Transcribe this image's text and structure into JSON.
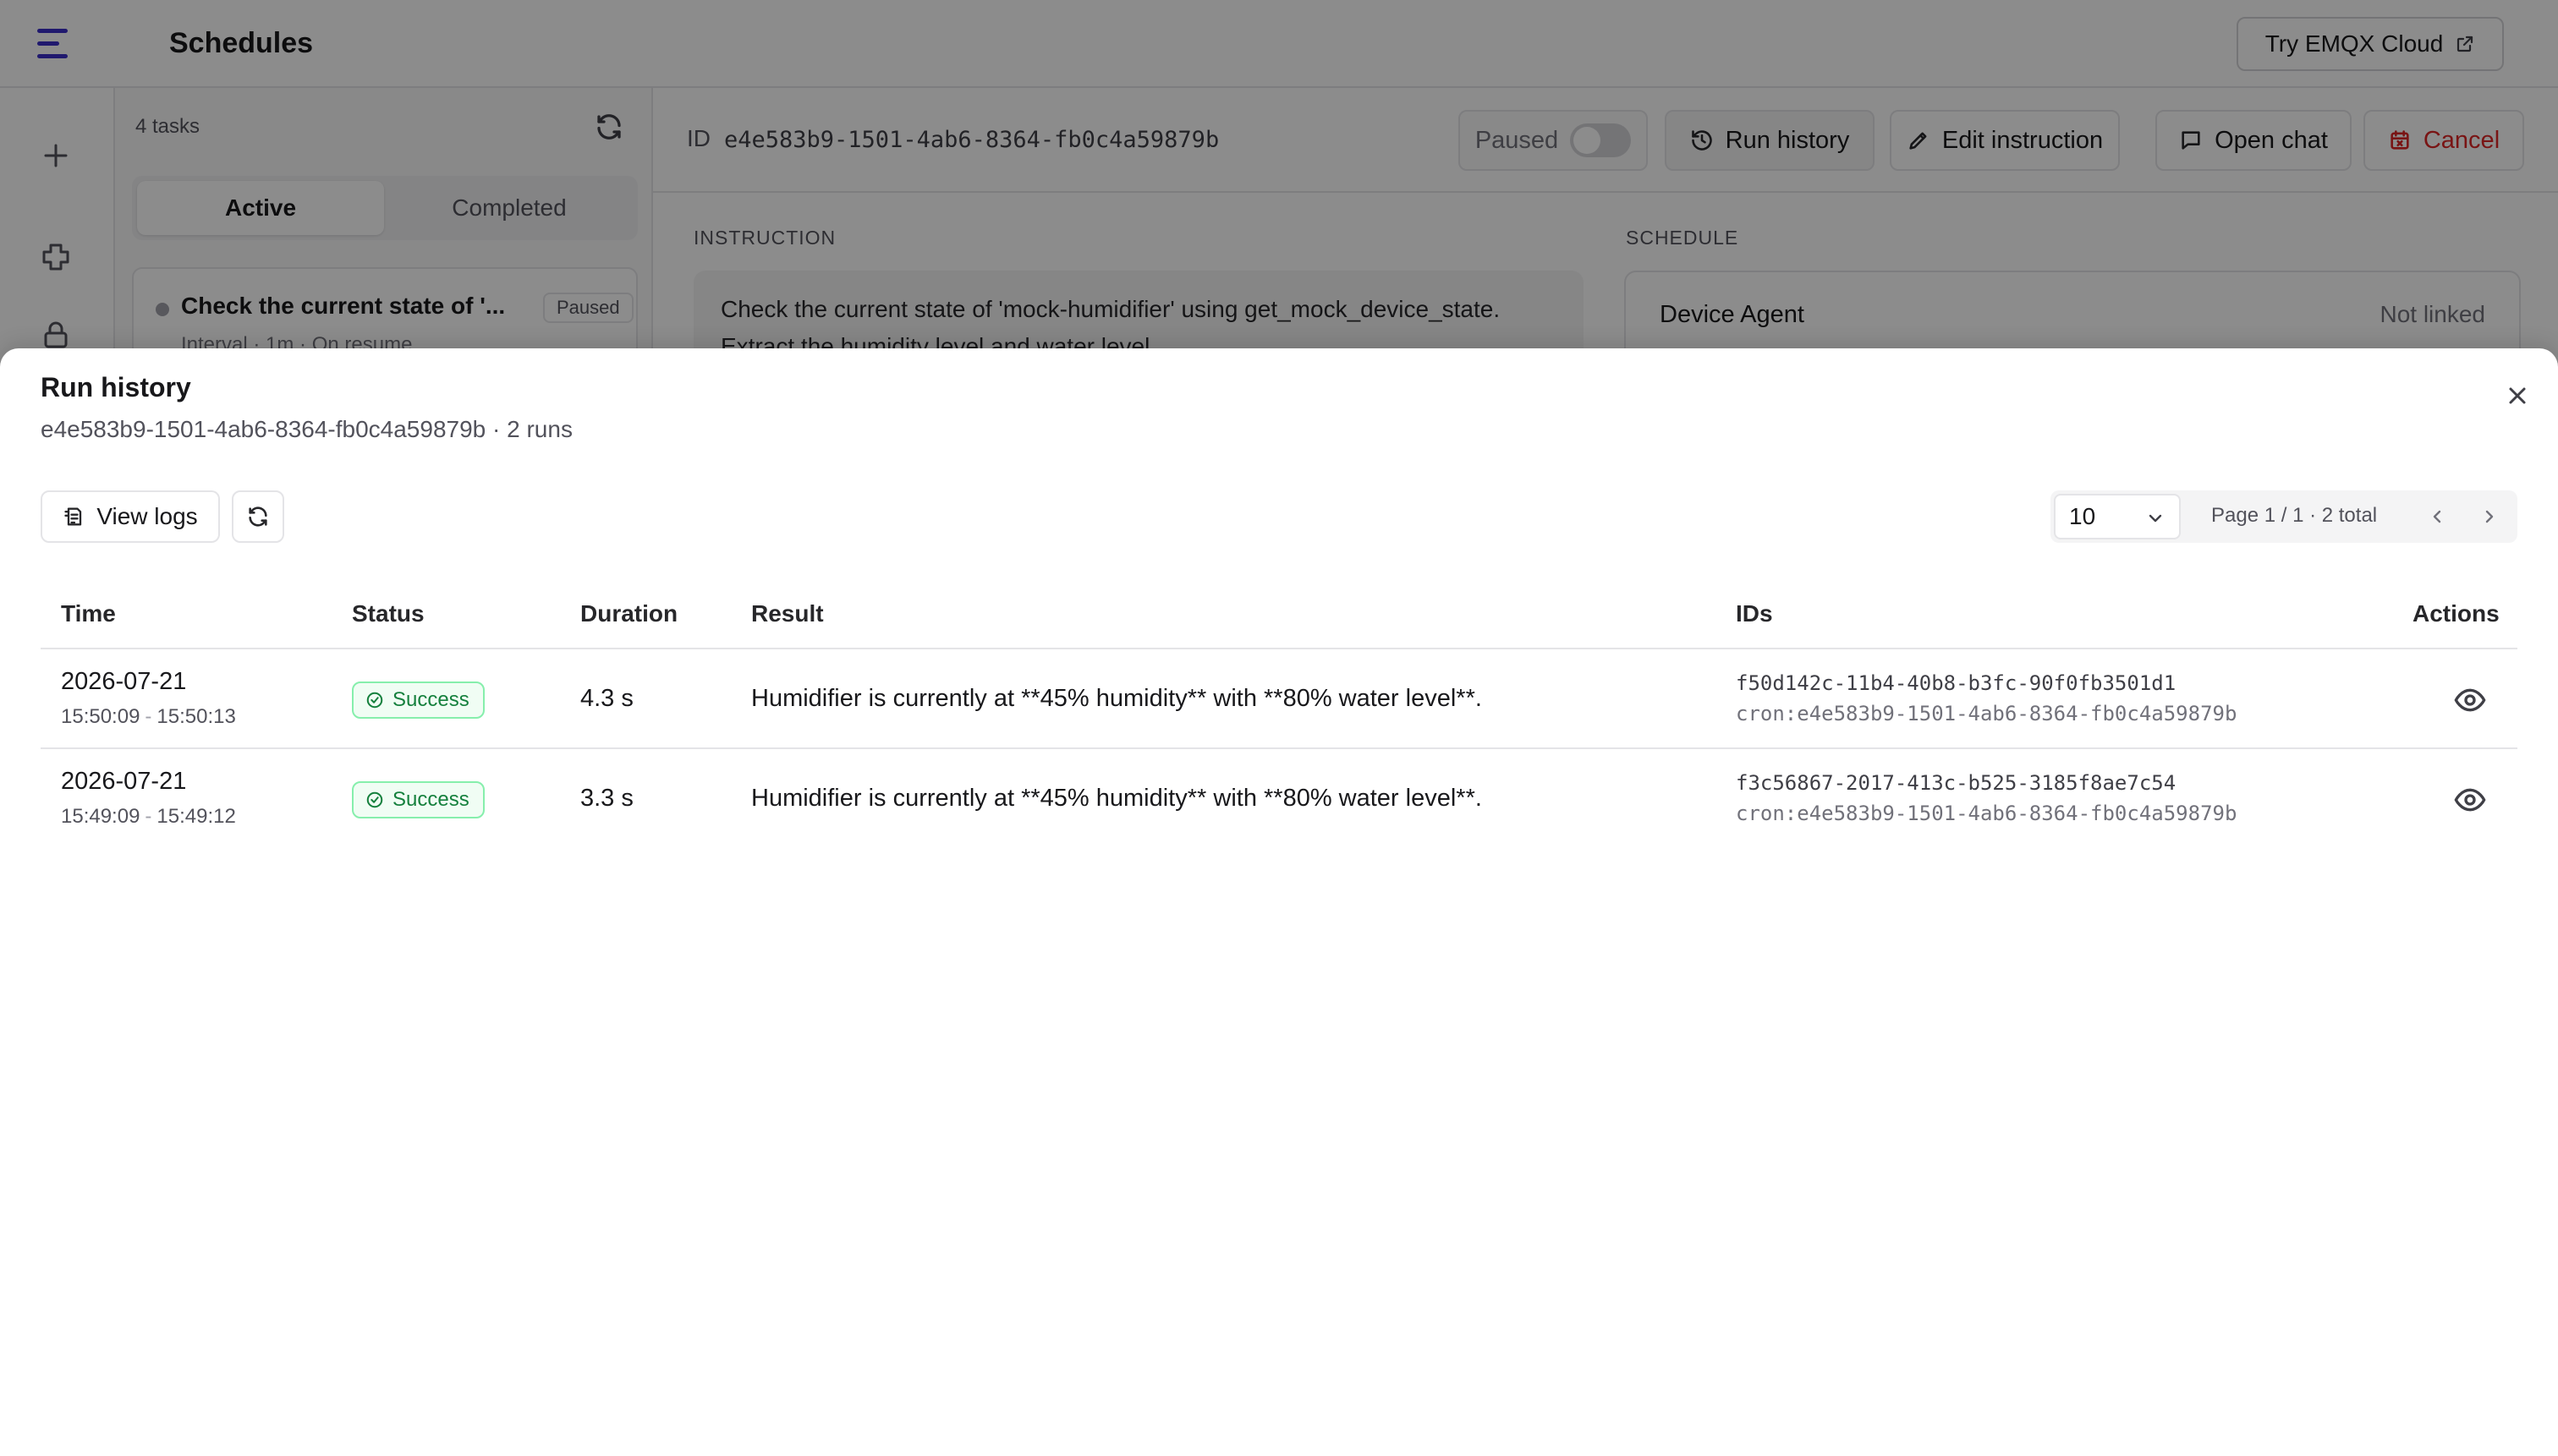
{
  "app": {
    "title": "Schedules",
    "try_button": "Try EMQX Cloud"
  },
  "list": {
    "count_label": "4 tasks",
    "tabs": [
      {
        "label": "Active"
      },
      {
        "label": "Completed"
      }
    ],
    "task": {
      "title": "Check the current state of '...",
      "badge": "Paused",
      "meta": "Interval · 1m · On resume"
    }
  },
  "detail": {
    "id_label": "ID",
    "id_value": "e4e583b9-1501-4ab6-8364-fb0c4a59879b",
    "paused_label": "Paused",
    "paused_on": false,
    "buttons": {
      "run_history": "Run history",
      "edit_instruction": "Edit instruction",
      "open_chat": "Open chat",
      "cancel": "Cancel"
    },
    "instruction_label": "INSTRUCTION",
    "instruction_text": "Check the current state of 'mock-humidifier' using get_mock_device_state. Extract the humidity level and water level",
    "schedule_label": "SCHEDULE",
    "schedule_name": "Device Agent",
    "schedule_status": "Not linked"
  },
  "drawer": {
    "title": "Run history",
    "subtitle": "e4e583b9-1501-4ab6-8364-fb0c4a59879b · 2 runs",
    "view_logs": "View logs",
    "page_size": "10",
    "page_info": "Page 1 / 1 · 2 total",
    "columns": {
      "time": "Time",
      "status": "Status",
      "duration": "Duration",
      "result": "Result",
      "ids": "IDs",
      "actions": "Actions"
    },
    "rows": [
      {
        "date": "2026-07-21",
        "start": "15:50:09",
        "sep": "-",
        "end": "15:50:13",
        "status": "Success",
        "duration": "4.3 s",
        "result": "Humidifier is currently at **45% humidity** with **80% water level**.",
        "run_id": "f50d142c-11b4-40b8-b3fc-90f0fb3501d1",
        "job_id": "cron:e4e583b9-1501-4ab6-8364-fb0c4a59879b"
      },
      {
        "date": "2026-07-21",
        "start": "15:49:09",
        "sep": "-",
        "end": "15:49:12",
        "status": "Success",
        "duration": "3.3 s",
        "result": "Humidifier is currently at **45% humidity** with **80% water level**.",
        "run_id": "f3c56867-2017-413c-b525-3185f8ae7c54",
        "job_id": "cron:e4e583b9-1501-4ab6-8364-fb0c4a59879b"
      }
    ]
  },
  "colors": {
    "accent": "#3b2fc9",
    "danger": "#dc2626",
    "success": "#15803d",
    "overlay": "rgba(0,0,0,0.45)"
  }
}
